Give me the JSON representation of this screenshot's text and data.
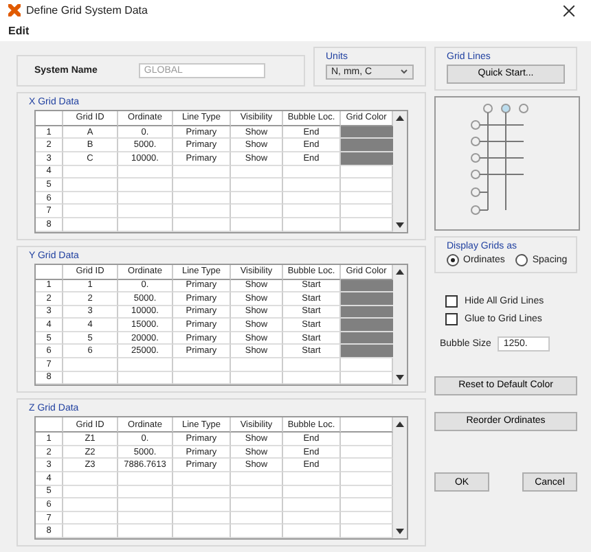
{
  "window": {
    "title": "Define Grid System Data"
  },
  "menu": [
    "Edit"
  ],
  "system_name": {
    "label": "System Name",
    "value": "GLOBAL",
    "disabled": true
  },
  "units": {
    "title": "Units",
    "value": "N, mm, C"
  },
  "grid_lines": {
    "title": "Grid Lines",
    "button": "Quick Start..."
  },
  "tables": [
    {
      "title": "X Grid Data",
      "columns": [
        "Grid ID",
        "Ordinate",
        "Line Type",
        "Visibility",
        "Bubble Loc.",
        "Grid Color"
      ],
      "row_numbers": [
        "1",
        "2",
        "3",
        "4",
        "5",
        "6",
        "7",
        "8"
      ],
      "rows": [
        {
          "cells": [
            "A",
            "0.",
            "Primary",
            "Show",
            "End"
          ],
          "color": "#808080"
        },
        {
          "cells": [
            "B",
            "5000.",
            "Primary",
            "Show",
            "End"
          ],
          "color": "#808080"
        },
        {
          "cells": [
            "C",
            "10000.",
            "Primary",
            "Show",
            "End"
          ],
          "color": "#808080"
        }
      ]
    },
    {
      "title": "Y Grid Data",
      "columns": [
        "Grid ID",
        "Ordinate",
        "Line Type",
        "Visibility",
        "Bubble Loc.",
        "Grid Color"
      ],
      "row_numbers": [
        "1",
        "2",
        "3",
        "4",
        "5",
        "6",
        "7",
        "8"
      ],
      "rows": [
        {
          "cells": [
            "1",
            "0.",
            "Primary",
            "Show",
            "Start"
          ],
          "color": "#808080"
        },
        {
          "cells": [
            "2",
            "5000.",
            "Primary",
            "Show",
            "Start"
          ],
          "color": "#808080"
        },
        {
          "cells": [
            "3",
            "10000.",
            "Primary",
            "Show",
            "Start"
          ],
          "color": "#808080"
        },
        {
          "cells": [
            "4",
            "15000.",
            "Primary",
            "Show",
            "Start"
          ],
          "color": "#808080"
        },
        {
          "cells": [
            "5",
            "20000.",
            "Primary",
            "Show",
            "Start"
          ],
          "color": "#808080"
        },
        {
          "cells": [
            "6",
            "25000.",
            "Primary",
            "Show",
            "Start"
          ],
          "color": "#808080"
        }
      ]
    },
    {
      "title": "Z Grid Data",
      "columns": [
        "Grid ID",
        "Ordinate",
        "Line Type",
        "Visibility",
        "Bubble Loc."
      ],
      "row_numbers": [
        "1",
        "2",
        "3",
        "4",
        "5",
        "6",
        "7",
        "8"
      ],
      "rows": [
        {
          "cells": [
            "Z1",
            "0.",
            "Primary",
            "Show",
            "End"
          ]
        },
        {
          "cells": [
            "Z2",
            "5000.",
            "Primary",
            "Show",
            "End"
          ]
        },
        {
          "cells": [
            "Z3",
            "7886.7613",
            "Primary",
            "Show",
            "End"
          ]
        }
      ]
    }
  ],
  "display": {
    "title": "Display Grids as",
    "options": [
      {
        "label": "Ordinates",
        "selected": true
      },
      {
        "label": "Spacing",
        "selected": false
      }
    ]
  },
  "checkboxes": [
    {
      "label": "Hide All Grid Lines",
      "checked": false
    },
    {
      "label": "Glue to Grid Lines",
      "checked": false
    }
  ],
  "bubble_size": {
    "label": "Bubble Size",
    "value": "1250."
  },
  "side_buttons": [
    "Reset to Default Color",
    "Reorder Ordinates"
  ],
  "buttons": [
    "OK",
    "Cancel"
  ]
}
